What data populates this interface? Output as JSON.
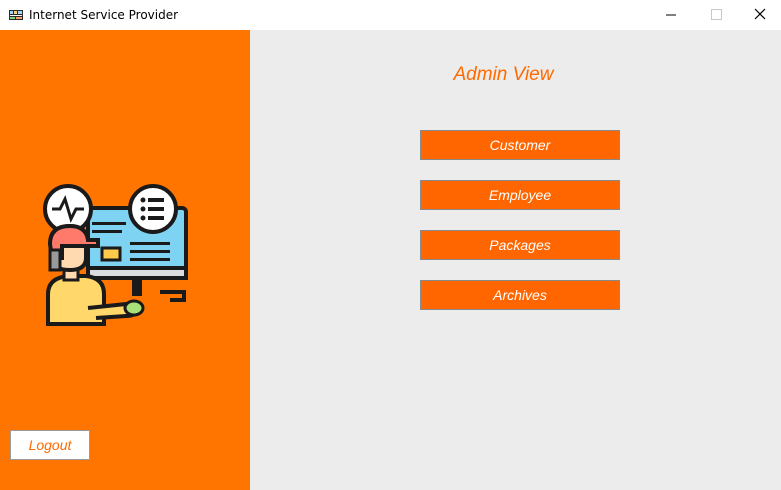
{
  "window": {
    "title": "Internet Service Provider",
    "icon": "network-app-icon"
  },
  "sidebar": {
    "illustration": "technician-computer-illustration",
    "logout_label": "Logout"
  },
  "main": {
    "title": "Admin View",
    "buttons": [
      {
        "label": "Customer"
      },
      {
        "label": "Employee"
      },
      {
        "label": "Packages"
      },
      {
        "label": "Archives"
      }
    ]
  },
  "colors": {
    "accent": "#ff7500",
    "button": "#ff6600",
    "text_accent": "#ff6a00",
    "panel": "#ececec"
  }
}
